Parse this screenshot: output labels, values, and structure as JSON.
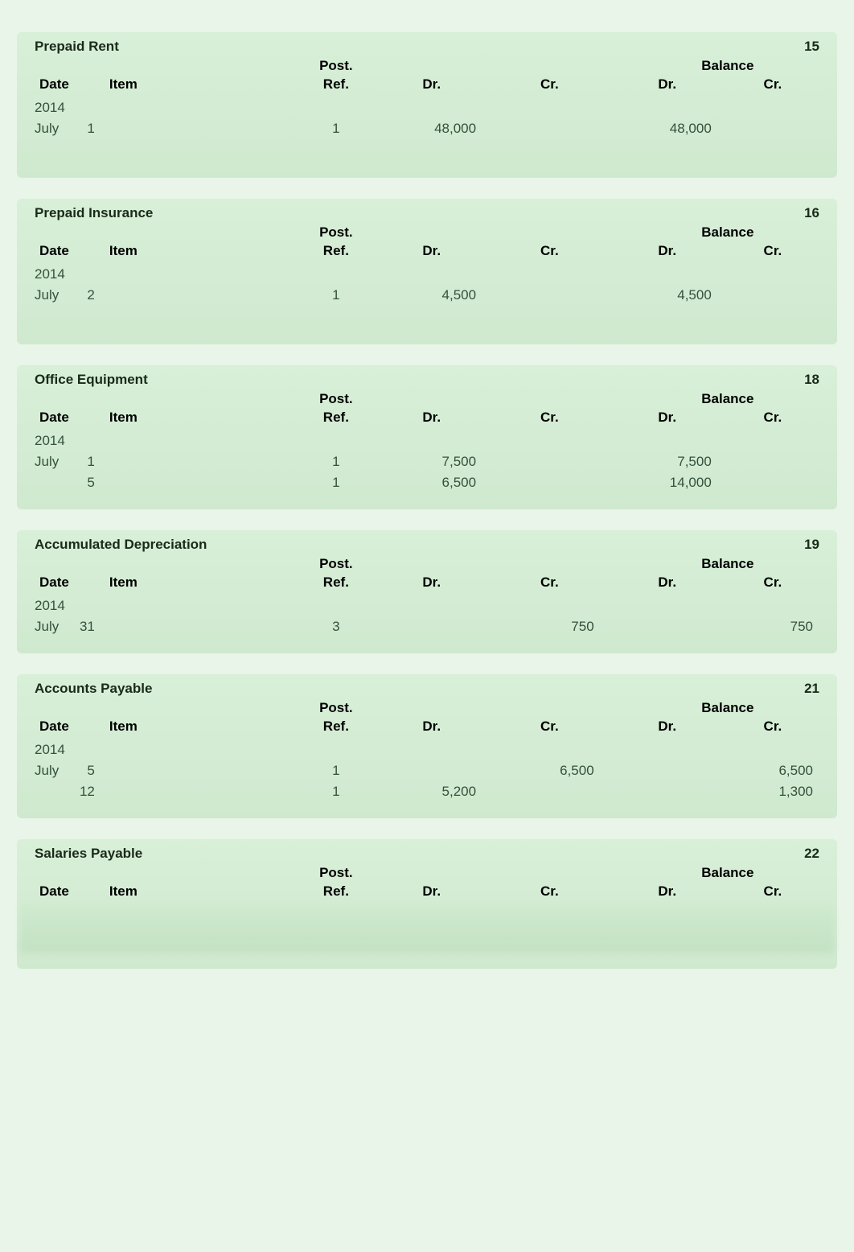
{
  "headers": {
    "date": "Date",
    "item": "Item",
    "post_super": "Post.",
    "ref": "Ref.",
    "dr": "Dr.",
    "cr": "Cr.",
    "balance_super": "Balance",
    "bdr": "Dr.",
    "bcr": "Cr."
  },
  "ledgers": [
    {
      "title": "Prepaid Rent",
      "number": "15",
      "year": "2014",
      "rows": [
        {
          "month": "July",
          "day": "1",
          "item": "",
          "ref": "1",
          "dr": "48,000",
          "cr": "",
          "bdr": "48,000",
          "bcr": ""
        }
      ],
      "trailing_space": true
    },
    {
      "title": "Prepaid Insurance",
      "number": "16",
      "year": "2014",
      "rows": [
        {
          "month": "July",
          "day": "2",
          "item": "",
          "ref": "1",
          "dr": "4,500",
          "cr": "",
          "bdr": "4,500",
          "bcr": ""
        }
      ],
      "trailing_space": true
    },
    {
      "title": "Office Equipment",
      "number": "18",
      "year": "2014",
      "rows": [
        {
          "month": "July",
          "day": "1",
          "item": "",
          "ref": "1",
          "dr": "7,500",
          "cr": "",
          "bdr": "7,500",
          "bcr": ""
        },
        {
          "month": "",
          "day": "5",
          "item": "",
          "ref": "1",
          "dr": "6,500",
          "cr": "",
          "bdr": "14,000",
          "bcr": ""
        }
      ]
    },
    {
      "title": "Accumulated Depreciation",
      "number": "19",
      "year": "2014",
      "rows": [
        {
          "month": "July",
          "day": "31",
          "item": "",
          "ref": "3",
          "dr": "",
          "cr": "750",
          "bdr": "",
          "bcr": "750"
        }
      ]
    },
    {
      "title": "Accounts Payable",
      "number": "21",
      "year": "2014",
      "rows": [
        {
          "month": "July",
          "day": "5",
          "item": "",
          "ref": "1",
          "dr": "",
          "cr": "6,500",
          "bdr": "",
          "bcr": "6,500"
        },
        {
          "month": "",
          "day": "12",
          "item": "",
          "ref": "1",
          "dr": "5,200",
          "cr": "",
          "bdr": "",
          "bcr": "1,300"
        }
      ]
    },
    {
      "title": "Salaries Payable",
      "number": "22",
      "year": "",
      "rows": [],
      "blurred": true
    }
  ]
}
